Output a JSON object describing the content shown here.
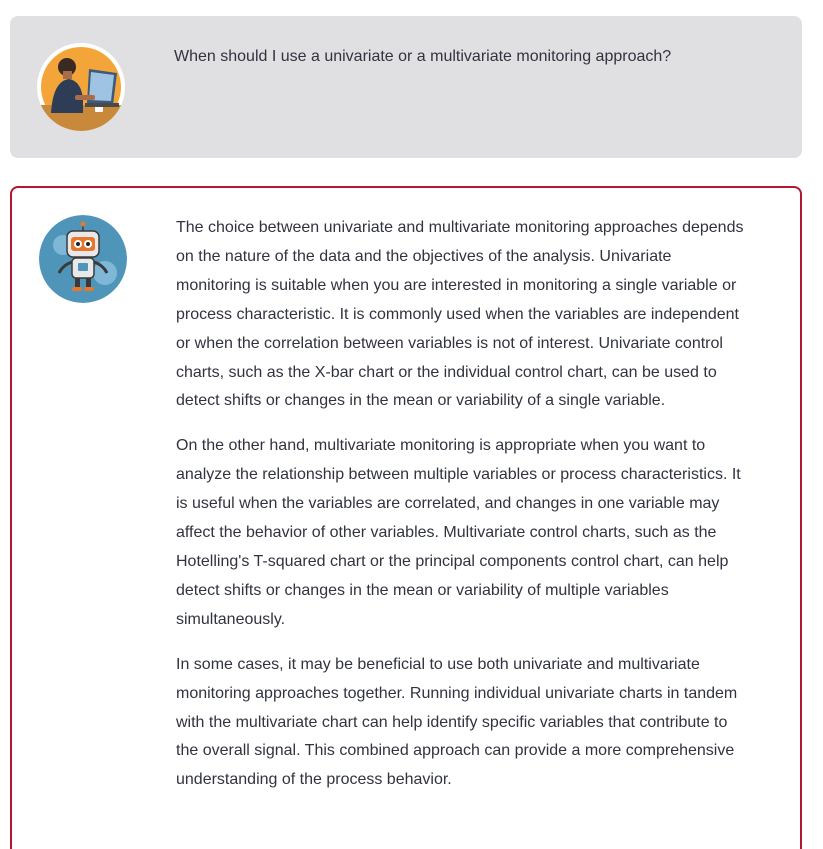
{
  "conversation": {
    "user_message": {
      "avatar_icon": "user-at-laptop-icon",
      "text": "When should I use a univariate or a multivariate monitoring approach?"
    },
    "assistant_message": {
      "avatar_icon": "robot-icon",
      "border_color": "#b5162f",
      "paragraphs": [
        "The choice between univariate and multivariate monitoring approaches depends on the nature of the data and the objectives of the analysis. Univariate monitoring is suitable when you are interested in monitoring a single variable or process characteristic. It is commonly used when the variables are independent or when the correlation between variables is not of interest. Univariate control charts, such as the X-bar chart or the individual control chart, can be used to detect shifts or changes in the mean or variability of a single variable.",
        "On the other hand, multivariate monitoring is appropriate when you want to analyze the relationship between multiple variables or process characteristics. It is useful when the variables are correlated, and changes in one variable may affect the behavior of other variables. Multivariate control charts, such as the Hotelling's T-squared chart or the principal components control chart, can help detect shifts or changes in the mean or variability of multiple variables simultaneously.",
        "In some cases, it may be beneficial to use both univariate and multivariate monitoring approaches together. Running individual univariate charts in tandem with the multivariate chart can help identify specific variables that contribute to the overall signal. This combined approach can provide a more comprehensive understanding of the process behavior."
      ]
    }
  }
}
